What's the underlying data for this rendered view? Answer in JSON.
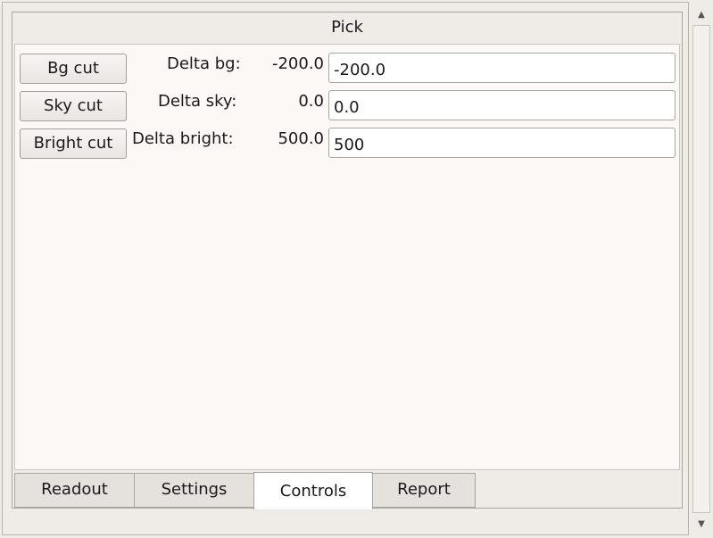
{
  "group": {
    "title": "Pick"
  },
  "rows": [
    {
      "button": "Bg cut",
      "label": "Delta bg:",
      "value": "-200.0",
      "input": "-200.0"
    },
    {
      "button": "Sky cut",
      "label": "Delta sky:",
      "value": "0.0",
      "input": "0.0"
    },
    {
      "button": "Bright cut",
      "label": "Delta bright:",
      "value": "500.0",
      "input": "500"
    }
  ],
  "tabs": [
    {
      "label": "Readout",
      "active": false
    },
    {
      "label": "Settings",
      "active": false
    },
    {
      "label": "Controls",
      "active": true
    },
    {
      "label": "Report",
      "active": false
    }
  ],
  "scrollbar": {
    "up_icon": "triangle-up",
    "down_icon": "triangle-down"
  }
}
